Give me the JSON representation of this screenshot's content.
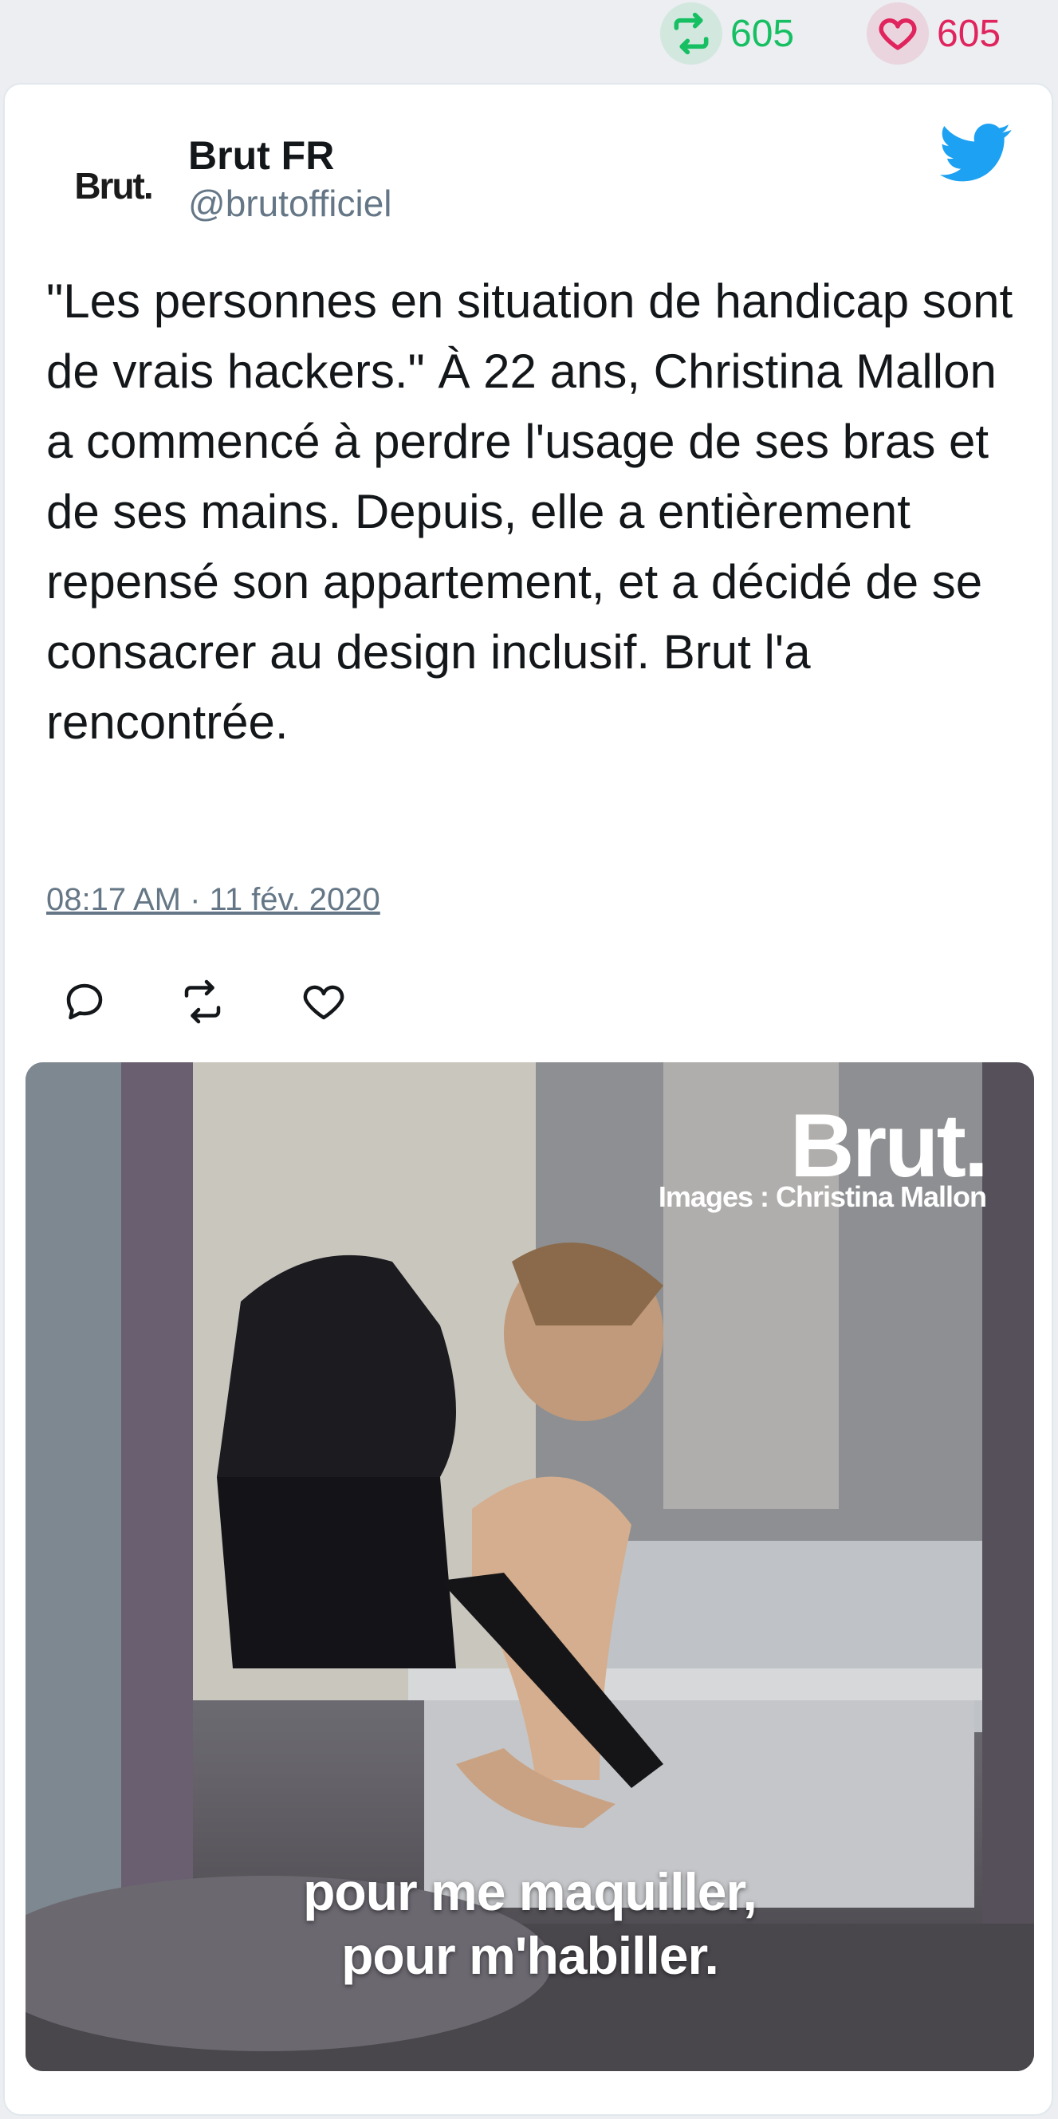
{
  "stats": {
    "retweets": "605",
    "likes": "605",
    "retweet_color": "#17bf63",
    "like_color": "#e0245e"
  },
  "tweet": {
    "avatar_text": "Brut.",
    "author_name": "Brut FR",
    "author_handle": "@brutofficiel",
    "icon_brand": "twitter-bird-icon",
    "text": "\"Les personnes en situation de handicap sont de vrais hackers.\" À 22 ans, Christina Mallon a commencé à perdre l'usage de ses bras et de ses mains. Depuis, elle a entièrement repensé son appartement, et a décidé de se consacrer au design inclusif. Brut l'a rencontrée.",
    "timestamp": "08:17 AM · 11 fév. 2020",
    "actions": [
      "reply-icon",
      "retweet-icon",
      "like-icon"
    ],
    "accent_color": "#1da1f2"
  },
  "media": {
    "brand": "Brut.",
    "credit": "Images : Christina Mallon",
    "subtitle_line1": "pour me maquiller,",
    "subtitle_line2": "pour m'habiller."
  }
}
